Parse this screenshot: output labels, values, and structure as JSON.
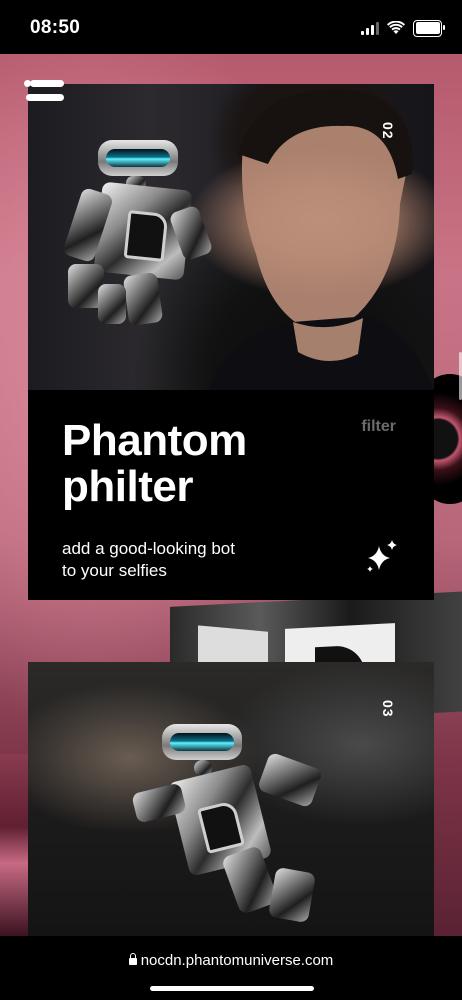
{
  "status_bar": {
    "time": "08:50"
  },
  "cards": [
    {
      "index": "02",
      "title_line1": "Phantom",
      "title_line2": "philter",
      "tag": "filter",
      "desc_line1": "add a good-looking bot",
      "desc_line2": "to your selfies"
    },
    {
      "index": "03"
    }
  ],
  "url_bar": {
    "url": "nocdn.phantomuniverse.com"
  },
  "colors": {
    "background_pink": "#c97486",
    "card": "#000000",
    "accent_visor": "#5ff3ff"
  }
}
